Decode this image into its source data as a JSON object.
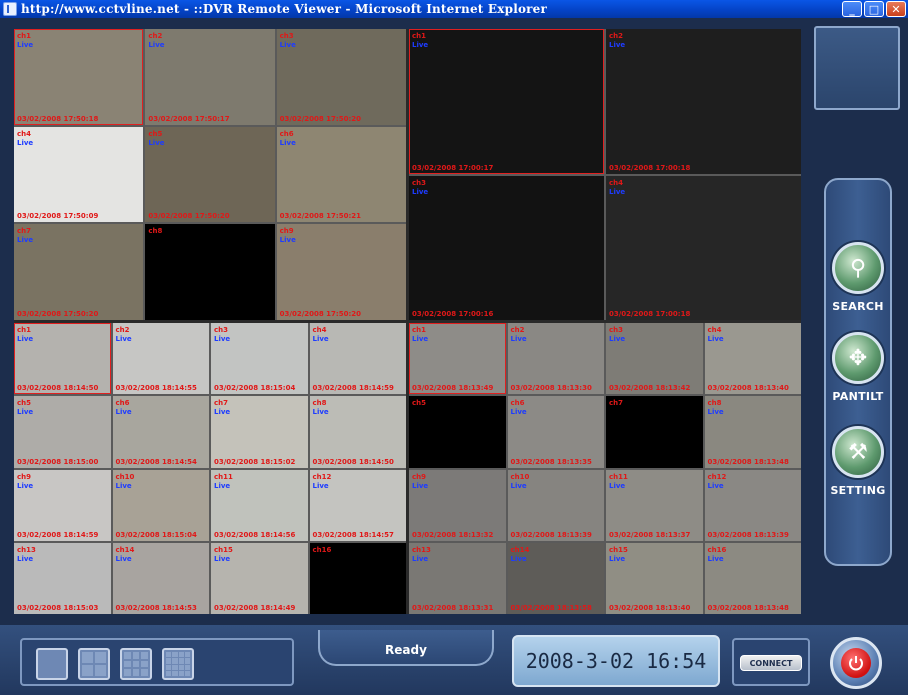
{
  "window": {
    "title": "http://www.cctvline.net - ::DVR Remote Viewer - Microsoft Internet Explorer",
    "minimize": "_",
    "maximize": "□",
    "close": "✕",
    "icon": "ie-page-icon"
  },
  "live_label": "Live",
  "quadrants": [
    {
      "cols": 3,
      "cells": [
        {
          "ch": "ch1",
          "ts": "03/02/2008 17:50:18",
          "live": true,
          "bg": "#8a8374",
          "sel": true
        },
        {
          "ch": "ch2",
          "ts": "03/02/2008 17:50:17",
          "live": true,
          "bg": "#7e7a6e"
        },
        {
          "ch": "ch3",
          "ts": "03/02/2008 17:50:20",
          "live": true,
          "bg": "#6f6a5c"
        },
        {
          "ch": "ch4",
          "ts": "03/02/2008 17:50:09",
          "live": true,
          "bg": "#e4e4e2"
        },
        {
          "ch": "ch5",
          "ts": "03/02/2008 17:50:20",
          "live": true,
          "bg": "#6e6656"
        },
        {
          "ch": "ch6",
          "ts": "03/02/2008 17:50:21",
          "live": true,
          "bg": "#8e8672"
        },
        {
          "ch": "ch7",
          "ts": "03/02/2008 17:50:20",
          "live": true,
          "bg": "#7a7362"
        },
        {
          "ch": "ch8",
          "ts": "",
          "live": false,
          "bg": "#000000"
        },
        {
          "ch": "ch9",
          "ts": "03/02/2008 17:50:20",
          "live": true,
          "bg": "#8a7e6c"
        }
      ]
    },
    {
      "cols": 2,
      "cells": [
        {
          "ch": "ch1",
          "ts": "03/02/2008 17:00:17",
          "live": true,
          "bg": "#141414",
          "sel": true
        },
        {
          "ch": "ch2",
          "ts": "03/02/2008 17:00:18",
          "live": true,
          "bg": "#1e1e1e"
        },
        {
          "ch": "ch3",
          "ts": "03/02/2008 17:00:16",
          "live": true,
          "bg": "#121212"
        },
        {
          "ch": "ch4",
          "ts": "03/02/2008 17:00:18",
          "live": true,
          "bg": "#262626"
        }
      ]
    },
    {
      "cols": 4,
      "cells": [
        {
          "ch": "ch1",
          "ts": "03/02/2008 18:14:50",
          "live": true,
          "bg": "#b4b2ae",
          "sel": true
        },
        {
          "ch": "ch2",
          "ts": "03/02/2008 18:14:55",
          "live": true,
          "bg": "#c6c6c4"
        },
        {
          "ch": "ch3",
          "ts": "03/02/2008 18:15:04",
          "live": true,
          "bg": "#c2c4c2"
        },
        {
          "ch": "ch4",
          "ts": "03/02/2008 18:14:59",
          "live": true,
          "bg": "#b8b8b4"
        },
        {
          "ch": "ch5",
          "ts": "03/02/2008 18:15:00",
          "live": true,
          "bg": "#aeaca8"
        },
        {
          "ch": "ch6",
          "ts": "03/02/2008 18:14:54",
          "live": true,
          "bg": "#a8a69e"
        },
        {
          "ch": "ch7",
          "ts": "03/02/2008 18:15:02",
          "live": true,
          "bg": "#c4c2ba"
        },
        {
          "ch": "ch8",
          "ts": "03/02/2008 18:14:50",
          "live": true,
          "bg": "#bcbcb6"
        },
        {
          "ch": "ch9",
          "ts": "03/02/2008 18:14:59",
          "live": true,
          "bg": "#c8c6c4"
        },
        {
          "ch": "ch10",
          "ts": "03/02/2008 18:15:04",
          "live": true,
          "bg": "#a8a296"
        },
        {
          "ch": "ch11",
          "ts": "03/02/2008 18:14:56",
          "live": true,
          "bg": "#c0c2bc"
        },
        {
          "ch": "ch12",
          "ts": "03/02/2008 18:14:57",
          "live": true,
          "bg": "#c4c4c0"
        },
        {
          "ch": "ch13",
          "ts": "03/02/2008 18:15:03",
          "live": true,
          "bg": "#bababa"
        },
        {
          "ch": "ch14",
          "ts": "03/02/2008 18:14:53",
          "live": true,
          "bg": "#a8a4a0"
        },
        {
          "ch": "ch15",
          "ts": "03/02/2008 18:14:49",
          "live": true,
          "bg": "#b6b4ae"
        },
        {
          "ch": "ch16",
          "ts": "",
          "live": false,
          "bg": "#000000"
        }
      ]
    },
    {
      "cols": 4,
      "cells": [
        {
          "ch": "ch1",
          "ts": "03/02/2008 18:13:49",
          "live": true,
          "bg": "#8e8c88",
          "sel": true
        },
        {
          "ch": "ch2",
          "ts": "03/02/2008 18:13:30",
          "live": true,
          "bg": "#8a8884"
        },
        {
          "ch": "ch3",
          "ts": "03/02/2008 18:13:42",
          "live": true,
          "bg": "#7e7c76"
        },
        {
          "ch": "ch4",
          "ts": "03/02/2008 18:13:40",
          "live": true,
          "bg": "#9a9890"
        },
        {
          "ch": "ch5",
          "ts": "",
          "live": false,
          "bg": "#000000"
        },
        {
          "ch": "ch6",
          "ts": "03/02/2008 18:13:35",
          "live": true,
          "bg": "#8c8a86"
        },
        {
          "ch": "ch7",
          "ts": "",
          "live": false,
          "bg": "#000000"
        },
        {
          "ch": "ch8",
          "ts": "03/02/2008 18:13:48",
          "live": true,
          "bg": "#8a8880"
        },
        {
          "ch": "ch9",
          "ts": "03/02/2008 18:13:32",
          "live": true,
          "bg": "#7c7a78"
        },
        {
          "ch": "ch10",
          "ts": "03/02/2008 18:13:39",
          "live": true,
          "bg": "#868480"
        },
        {
          "ch": "ch11",
          "ts": "03/02/2008 18:13:37",
          "live": true,
          "bg": "#8e8c86"
        },
        {
          "ch": "ch12",
          "ts": "03/02/2008 18:13:39",
          "live": true,
          "bg": "#8a8884"
        },
        {
          "ch": "ch13",
          "ts": "03/02/2008 18:13:31",
          "live": true,
          "bg": "#7a7874"
        },
        {
          "ch": "ch14",
          "ts": "03/02/2008 18:13:58",
          "live": true,
          "bg": "#5e5c58"
        },
        {
          "ch": "ch15",
          "ts": "03/02/2008 18:13:40",
          "live": true,
          "bg": "#908e84"
        },
        {
          "ch": "ch16",
          "ts": "03/02/2008 18:13:48",
          "live": true,
          "bg": "#8c8a82"
        }
      ]
    }
  ],
  "controls": {
    "search": {
      "label": "SEARCH",
      "icon": "magnifier-icon"
    },
    "pantilt": {
      "label": "PANTILT",
      "icon": "pantilt-arrows-icon"
    },
    "setting": {
      "label": "SETTING",
      "icon": "tools-icon"
    }
  },
  "status": {
    "text": "Ready"
  },
  "datetime": "2008-3-02 16:54",
  "connect_label": "CONNECT",
  "colors": {
    "accent": "#2a4470",
    "channel_text": "#e01818",
    "live_text": "#1e3cff",
    "selected_border": "#e02020"
  }
}
